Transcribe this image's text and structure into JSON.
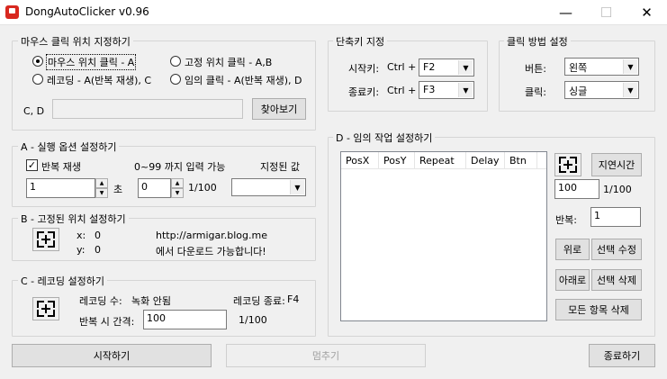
{
  "window": {
    "title": "DongAutoClicker v0.96",
    "controls": [
      "—",
      "☐",
      "✕"
    ]
  },
  "mouse_pos_group": {
    "title": "마우스 클릭 위치 지정하기",
    "radio_current": "마우스 위치 클릭 - A",
    "radio_fixed": "고정 위치 클릭 - A,B",
    "radio_recording": "레코딩 - A(반복 재생), C",
    "radio_random": "임의 클릭 - A(반복 재생), D",
    "selected": "current",
    "cd_label": "C, D",
    "cd_value": "",
    "browse_button": "찾아보기"
  },
  "hotkey_group": {
    "title": "단축키 지정",
    "start_label": "시작키:",
    "start_mod": "Ctrl +",
    "start_key": "F2",
    "stop_label": "종료키:",
    "stop_mod": "Ctrl +",
    "stop_key": "F3"
  },
  "click_method_group": {
    "title": "클릭 방법 설정",
    "button_label": "버튼:",
    "button_value": "왼쪽",
    "click_label": "클릭:",
    "click_value": "싱글"
  },
  "options_group": {
    "title": "A - 실행 옵션 설정하기",
    "repeat_label": "반복 재생",
    "repeat_checked": true,
    "range_label": "0~99 까지 입력 가능",
    "specified_label": "지정된 값",
    "seconds_value": "1",
    "seconds_unit": "초",
    "fraction_value": "0",
    "fraction_unit": "1/100",
    "specified_value": ""
  },
  "fixed_pos_group": {
    "title": "B - 고정된 위치 설정하기",
    "x_label": "x:",
    "x_value": "0",
    "y_label": "y:",
    "y_value": "0",
    "url": "http://armigar.blog.me",
    "download_text": "에서 다운로드 가능합니다!"
  },
  "recording_group": {
    "title": "C - 레코딩 설정하기",
    "count_label": "레코딩 수:",
    "count_value": "녹화 안됨",
    "end_label": "레코딩 종료:",
    "end_value": "F4",
    "interval_label": "반복 시 간격:",
    "interval_value": "100",
    "interval_unit": "1/100"
  },
  "random_group": {
    "title": "D - 임의 작업 설정하기",
    "columns": [
      "PosX",
      "PosY",
      "Repeat",
      "Delay",
      "Btn"
    ],
    "delay_button": "지연시간",
    "delay_value": "100",
    "delay_unit": "1/100",
    "repeat_label": "반복:",
    "repeat_value": "1",
    "up_button": "위로",
    "edit_button": "선택 수정",
    "down_button": "아래로",
    "delete_button": "선택 삭제",
    "delete_all_button": "모든 항목 삭제"
  },
  "footer": {
    "start_button": "시작하기",
    "stop_button": "멈추기",
    "exit_button": "종료하기"
  }
}
